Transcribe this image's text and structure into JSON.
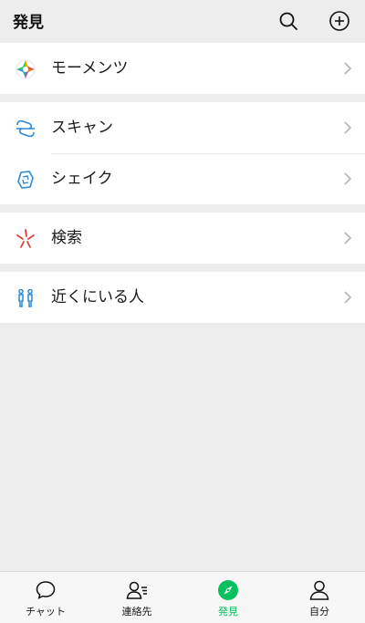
{
  "header": {
    "title": "発見",
    "search_icon": "search-icon",
    "add_icon": "plus-circle-icon"
  },
  "groups": [
    {
      "items": [
        {
          "label": "モーメンツ",
          "icon": "moments-aperture-icon"
        }
      ]
    },
    {
      "items": [
        {
          "label": "スキャン",
          "icon": "scan-icon"
        },
        {
          "label": "シェイク",
          "icon": "shake-icon"
        }
      ]
    },
    {
      "items": [
        {
          "label": "検索",
          "icon": "search-star-icon"
        }
      ]
    },
    {
      "items": [
        {
          "label": "近くにいる人",
          "icon": "people-nearby-icon"
        }
      ]
    }
  ],
  "tabbar": {
    "tabs": [
      {
        "label": "チャット",
        "icon": "chat-bubble-icon",
        "active": false
      },
      {
        "label": "連絡先",
        "icon": "contacts-icon",
        "active": false
      },
      {
        "label": "発見",
        "icon": "compass-icon",
        "active": true
      },
      {
        "label": "自分",
        "icon": "person-icon",
        "active": false
      }
    ]
  },
  "colors": {
    "accent": "#07c160",
    "background": "#ededed",
    "panel": "#ffffff"
  }
}
